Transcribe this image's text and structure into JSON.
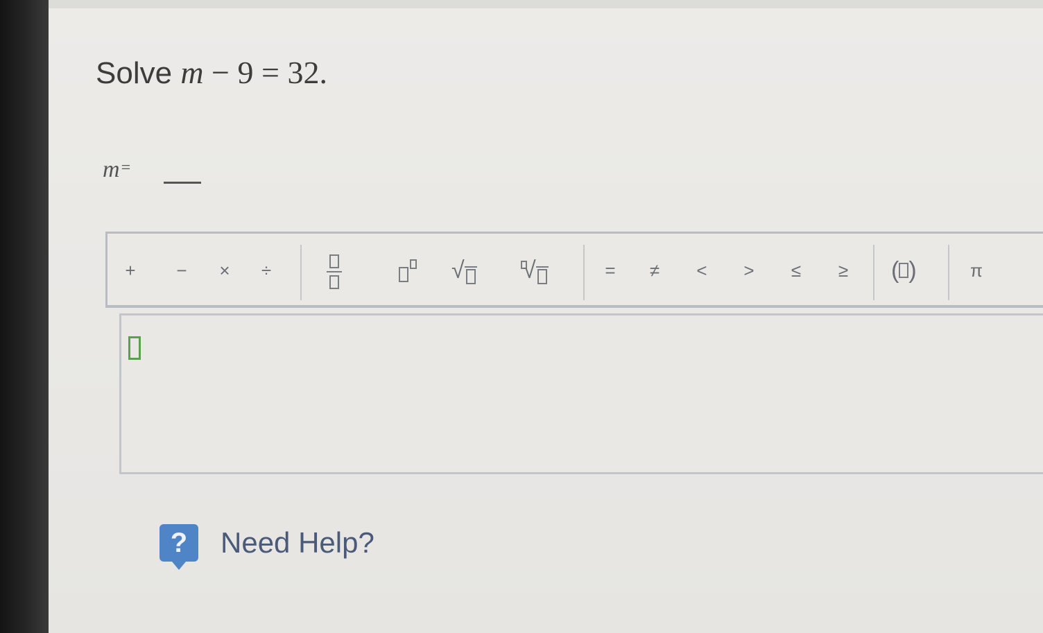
{
  "question": {
    "prefix": "Solve",
    "var": "m",
    "op": "−",
    "constant": "9",
    "eq": "=",
    "rhs": "32",
    "end": "."
  },
  "answer": {
    "var": "m",
    "eq": "=",
    "value": ""
  },
  "toolbar": {
    "plus": "+",
    "minus": "−",
    "times": "×",
    "divide": "÷",
    "equals": "=",
    "not_equal": "≠",
    "less_than": "<",
    "greater_than": ">",
    "less_equal": "≤",
    "greater_equal": "≥",
    "paren_open": "(",
    "paren_close": ")",
    "pi": "π"
  },
  "icons": {
    "fraction": "fraction-icon",
    "exponent": "exponent-icon",
    "square_root": "square-root-icon",
    "nth_root": "nth-root-icon",
    "parentheses": "parentheses-icon",
    "help": "help-icon"
  },
  "help": {
    "icon_glyph": "?",
    "label": "Need Help?"
  },
  "colors": {
    "help_icon": "#4f84c6",
    "help_text": "#4a5a78",
    "cursor": "#5aa04e"
  }
}
